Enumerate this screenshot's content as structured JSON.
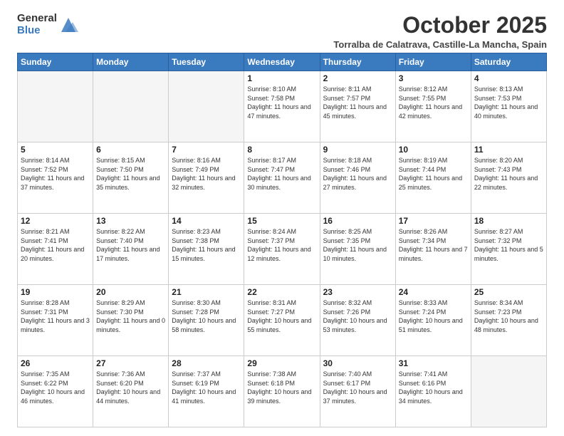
{
  "logo": {
    "general": "General",
    "blue": "Blue"
  },
  "title": "October 2025",
  "location": "Torralba de Calatrava, Castille-La Mancha, Spain",
  "days_of_week": [
    "Sunday",
    "Monday",
    "Tuesday",
    "Wednesday",
    "Thursday",
    "Friday",
    "Saturday"
  ],
  "weeks": [
    [
      {
        "day": "",
        "info": ""
      },
      {
        "day": "",
        "info": ""
      },
      {
        "day": "",
        "info": ""
      },
      {
        "day": "1",
        "info": "Sunrise: 8:10 AM\nSunset: 7:58 PM\nDaylight: 11 hours and 47 minutes."
      },
      {
        "day": "2",
        "info": "Sunrise: 8:11 AM\nSunset: 7:57 PM\nDaylight: 11 hours and 45 minutes."
      },
      {
        "day": "3",
        "info": "Sunrise: 8:12 AM\nSunset: 7:55 PM\nDaylight: 11 hours and 42 minutes."
      },
      {
        "day": "4",
        "info": "Sunrise: 8:13 AM\nSunset: 7:53 PM\nDaylight: 11 hours and 40 minutes."
      }
    ],
    [
      {
        "day": "5",
        "info": "Sunrise: 8:14 AM\nSunset: 7:52 PM\nDaylight: 11 hours and 37 minutes."
      },
      {
        "day": "6",
        "info": "Sunrise: 8:15 AM\nSunset: 7:50 PM\nDaylight: 11 hours and 35 minutes."
      },
      {
        "day": "7",
        "info": "Sunrise: 8:16 AM\nSunset: 7:49 PM\nDaylight: 11 hours and 32 minutes."
      },
      {
        "day": "8",
        "info": "Sunrise: 8:17 AM\nSunset: 7:47 PM\nDaylight: 11 hours and 30 minutes."
      },
      {
        "day": "9",
        "info": "Sunrise: 8:18 AM\nSunset: 7:46 PM\nDaylight: 11 hours and 27 minutes."
      },
      {
        "day": "10",
        "info": "Sunrise: 8:19 AM\nSunset: 7:44 PM\nDaylight: 11 hours and 25 minutes."
      },
      {
        "day": "11",
        "info": "Sunrise: 8:20 AM\nSunset: 7:43 PM\nDaylight: 11 hours and 22 minutes."
      }
    ],
    [
      {
        "day": "12",
        "info": "Sunrise: 8:21 AM\nSunset: 7:41 PM\nDaylight: 11 hours and 20 minutes."
      },
      {
        "day": "13",
        "info": "Sunrise: 8:22 AM\nSunset: 7:40 PM\nDaylight: 11 hours and 17 minutes."
      },
      {
        "day": "14",
        "info": "Sunrise: 8:23 AM\nSunset: 7:38 PM\nDaylight: 11 hours and 15 minutes."
      },
      {
        "day": "15",
        "info": "Sunrise: 8:24 AM\nSunset: 7:37 PM\nDaylight: 11 hours and 12 minutes."
      },
      {
        "day": "16",
        "info": "Sunrise: 8:25 AM\nSunset: 7:35 PM\nDaylight: 11 hours and 10 minutes."
      },
      {
        "day": "17",
        "info": "Sunrise: 8:26 AM\nSunset: 7:34 PM\nDaylight: 11 hours and 7 minutes."
      },
      {
        "day": "18",
        "info": "Sunrise: 8:27 AM\nSunset: 7:32 PM\nDaylight: 11 hours and 5 minutes."
      }
    ],
    [
      {
        "day": "19",
        "info": "Sunrise: 8:28 AM\nSunset: 7:31 PM\nDaylight: 11 hours and 3 minutes."
      },
      {
        "day": "20",
        "info": "Sunrise: 8:29 AM\nSunset: 7:30 PM\nDaylight: 11 hours and 0 minutes."
      },
      {
        "day": "21",
        "info": "Sunrise: 8:30 AM\nSunset: 7:28 PM\nDaylight: 10 hours and 58 minutes."
      },
      {
        "day": "22",
        "info": "Sunrise: 8:31 AM\nSunset: 7:27 PM\nDaylight: 10 hours and 55 minutes."
      },
      {
        "day": "23",
        "info": "Sunrise: 8:32 AM\nSunset: 7:26 PM\nDaylight: 10 hours and 53 minutes."
      },
      {
        "day": "24",
        "info": "Sunrise: 8:33 AM\nSunset: 7:24 PM\nDaylight: 10 hours and 51 minutes."
      },
      {
        "day": "25",
        "info": "Sunrise: 8:34 AM\nSunset: 7:23 PM\nDaylight: 10 hours and 48 minutes."
      }
    ],
    [
      {
        "day": "26",
        "info": "Sunrise: 7:35 AM\nSunset: 6:22 PM\nDaylight: 10 hours and 46 minutes."
      },
      {
        "day": "27",
        "info": "Sunrise: 7:36 AM\nSunset: 6:20 PM\nDaylight: 10 hours and 44 minutes."
      },
      {
        "day": "28",
        "info": "Sunrise: 7:37 AM\nSunset: 6:19 PM\nDaylight: 10 hours and 41 minutes."
      },
      {
        "day": "29",
        "info": "Sunrise: 7:38 AM\nSunset: 6:18 PM\nDaylight: 10 hours and 39 minutes."
      },
      {
        "day": "30",
        "info": "Sunrise: 7:40 AM\nSunset: 6:17 PM\nDaylight: 10 hours and 37 minutes."
      },
      {
        "day": "31",
        "info": "Sunrise: 7:41 AM\nSunset: 6:16 PM\nDaylight: 10 hours and 34 minutes."
      },
      {
        "day": "",
        "info": ""
      }
    ]
  ]
}
